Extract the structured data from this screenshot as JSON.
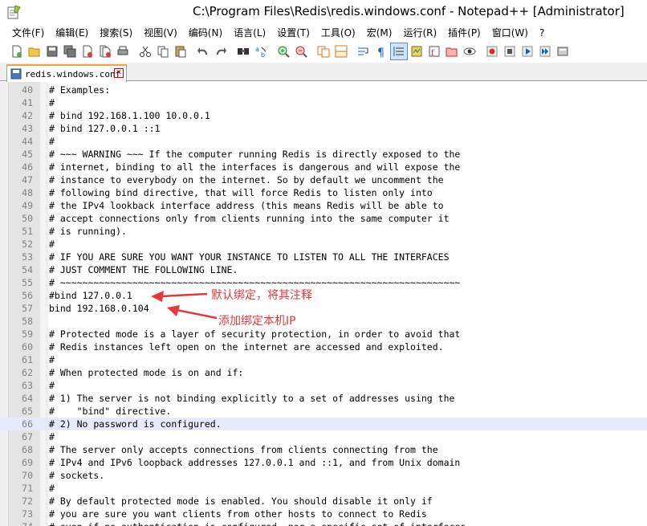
{
  "window": {
    "title": "C:\\Program Files\\Redis\\redis.windows.conf - Notepad++ [Administrator]"
  },
  "menu": [
    "文件(F)",
    "编辑(E)",
    "搜索(S)",
    "视图(V)",
    "编码(N)",
    "语言(L)",
    "设置(T)",
    "工具(O)",
    "宏(M)",
    "运行(R)",
    "插件(P)",
    "窗口(W)",
    "?"
  ],
  "toolbar": {
    "icons": [
      "new-file-icon",
      "open-file-icon",
      "save-icon",
      "save-all-icon",
      "close-icon",
      "close-all-icon",
      "print-icon",
      "cut-icon",
      "copy-icon",
      "paste-icon",
      "undo-icon",
      "redo-icon",
      "find-icon",
      "replace-icon",
      "zoom-in-icon",
      "zoom-out-icon",
      "sync-vertical-icon",
      "sync-horizontal-icon",
      "word-wrap-icon",
      "show-all-chars-icon",
      "indent-guide-icon",
      "doc-map-icon",
      "function-list-icon",
      "folder-workspace-icon",
      "monitor-icon",
      "record-macro-icon",
      "stop-macro-icon",
      "play-macro-icon",
      "run-macro-multiple-icon",
      "save-macro-icon"
    ]
  },
  "tab": {
    "label": "redis.windows.conf",
    "close": "✕"
  },
  "editor": {
    "current_line": 66,
    "lines": [
      {
        "n": "40",
        "text": "# Examples:"
      },
      {
        "n": "41",
        "text": "#"
      },
      {
        "n": "42",
        "text": "# bind 192.168.1.100 10.0.0.1"
      },
      {
        "n": "43",
        "text": "# bind 127.0.0.1 ::1"
      },
      {
        "n": "44",
        "text": "#"
      },
      {
        "n": "45",
        "text": "# ~~~ WARNING ~~~ If the computer running Redis is directly exposed to the"
      },
      {
        "n": "46",
        "text": "# internet, binding to all the interfaces is dangerous and will expose the"
      },
      {
        "n": "47",
        "text": "# instance to everybody on the internet. So by default we uncomment the"
      },
      {
        "n": "48",
        "text": "# following bind directive, that will force Redis to listen only into"
      },
      {
        "n": "49",
        "text": "# the IPv4 lookback interface address (this means Redis will be able to"
      },
      {
        "n": "50",
        "text": "# accept connections only from clients running into the same computer it"
      },
      {
        "n": "51",
        "text": "# is running)."
      },
      {
        "n": "52",
        "text": "#"
      },
      {
        "n": "53",
        "text": "# IF YOU ARE SURE YOU WANT YOUR INSTANCE TO LISTEN TO ALL THE INTERFACES"
      },
      {
        "n": "54",
        "text": "# JUST COMMENT THE FOLLOWING LINE."
      },
      {
        "n": "55",
        "text": "# ~~~~~~~~~~~~~~~~~~~~~~~~~~~~~~~~~~~~~~~~~~~~~~~~~~~~~~~~~~~~~~~~~~~~~~~~"
      },
      {
        "n": "56",
        "text": "#bind 127.0.0.1"
      },
      {
        "n": "57",
        "text": "bind 192.168.0.104"
      },
      {
        "n": "58",
        "text": ""
      },
      {
        "n": "59",
        "text": "# Protected mode is a layer of security protection, in order to avoid that"
      },
      {
        "n": "60",
        "text": "# Redis instances left open on the internet are accessed and exploited."
      },
      {
        "n": "61",
        "text": "#"
      },
      {
        "n": "62",
        "text": "# When protected mode is on and if:"
      },
      {
        "n": "63",
        "text": "#"
      },
      {
        "n": "64",
        "text": "# 1) The server is not binding explicitly to a set of addresses using the"
      },
      {
        "n": "65",
        "text": "#    \"bind\" directive."
      },
      {
        "n": "66",
        "text": "# 2) No password is configured."
      },
      {
        "n": "67",
        "text": "#"
      },
      {
        "n": "68",
        "text": "# The server only accepts connections from clients connecting from the"
      },
      {
        "n": "69",
        "text": "# IPv4 and IPv6 loopback addresses 127.0.0.1 and ::1, and from Unix domain"
      },
      {
        "n": "70",
        "text": "# sockets."
      },
      {
        "n": "71",
        "text": "#"
      },
      {
        "n": "72",
        "text": "# By default protected mode is enabled. You should disable it only if"
      },
      {
        "n": "73",
        "text": "# you are sure you want clients from other hosts to connect to Redis"
      },
      {
        "n": "74",
        "text": "# even if no authentication is configured, nor a specific set of interfaces"
      }
    ]
  },
  "annotations": {
    "comment_default_bind": "默认绑定，将其注释",
    "add_local_ip": "添加绑定本机IP",
    "color": "#e8373a"
  }
}
